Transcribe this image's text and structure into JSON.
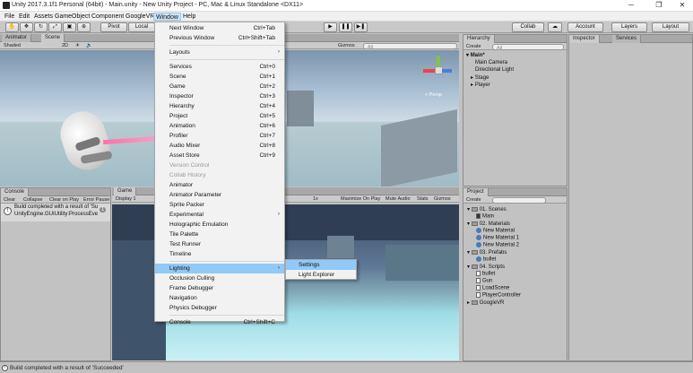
{
  "window": {
    "title": "Unity 2017.3.1f1 Personal (64bit) - Main.unity - New Unity Project - PC, Mac & Linux Standalone <DX11>",
    "minimize": "─",
    "maximize": "❐",
    "close": "✕"
  },
  "menubar": [
    "File",
    "Edit",
    "Assets",
    "GameObject",
    "Component",
    "GoogleVR",
    "Window",
    "Help"
  ],
  "toolbar": {
    "pivot": "Pivot",
    "local": "Local",
    "collab": "Collab",
    "account": "Account",
    "layers": "Layers",
    "layout": "Layout"
  },
  "scene_panel": {
    "tabs": [
      "Animator",
      "Scene"
    ],
    "shaded": "Shaded",
    "mode_2d": "2D",
    "gizmos": "Gizmos",
    "search_placeholder": "All",
    "persp": "< Persp"
  },
  "hierarchy": {
    "tab": "Hierarchy",
    "create": "Create",
    "search_placeholder": "All",
    "scene": "Main*",
    "items": [
      "Main Camera",
      "Directional Light",
      "Stage",
      "Player"
    ]
  },
  "inspector": {
    "tabs": [
      "Inspector",
      "Services"
    ]
  },
  "console": {
    "tab": "Console",
    "buttons": [
      "Clear",
      "Collapse",
      "Clear on Play",
      "Error Pause"
    ],
    "log_line1": "Build completed with a result of 'Su",
    "log_line2": "UnityEngine.GUIUtility:ProcessEve",
    "count": "1"
  },
  "game_panel": {
    "tab": "Game",
    "display": "Display 1",
    "scale": "1x",
    "options": [
      "Maximize On Play",
      "Mute Audio",
      "Stats",
      "Gizmos"
    ]
  },
  "project": {
    "tab": "Project",
    "create": "Create",
    "items": [
      {
        "label": "01. Scenes",
        "type": "folder",
        "depth": 0
      },
      {
        "label": "Main",
        "type": "scene",
        "depth": 1
      },
      {
        "label": "02. Materials",
        "type": "folder",
        "depth": 0
      },
      {
        "label": "New Material",
        "type": "asset",
        "depth": 1
      },
      {
        "label": "New Material 1",
        "type": "asset",
        "depth": 1
      },
      {
        "label": "New Material 2",
        "type": "asset",
        "depth": 1
      },
      {
        "label": "03. Prefabs",
        "type": "folder",
        "depth": 0
      },
      {
        "label": "bullet",
        "type": "asset",
        "depth": 1
      },
      {
        "label": "04. Scripts",
        "type": "folder",
        "depth": 0
      },
      {
        "label": "bullet",
        "type": "script",
        "depth": 1
      },
      {
        "label": "Gun",
        "type": "script",
        "depth": 1
      },
      {
        "label": "LoadScene",
        "type": "script",
        "depth": 1
      },
      {
        "label": "PlayerController",
        "type": "script",
        "depth": 1
      },
      {
        "label": "GoogleVR",
        "type": "folder",
        "depth": 0
      }
    ]
  },
  "window_menu": {
    "items": [
      {
        "label": "Next Window",
        "shortcut": "Ctrl+Tab"
      },
      {
        "label": "Previous Window",
        "shortcut": "Ctrl+Shift+Tab"
      },
      {
        "sep": true
      },
      {
        "label": "Layouts",
        "submenu": true
      },
      {
        "sep": true
      },
      {
        "label": "Services",
        "shortcut": "Ctrl+0"
      },
      {
        "label": "Scene",
        "shortcut": "Ctrl+1"
      },
      {
        "label": "Game",
        "shortcut": "Ctrl+2"
      },
      {
        "label": "Inspector",
        "shortcut": "Ctrl+3"
      },
      {
        "label": "Hierarchy",
        "shortcut": "Ctrl+4"
      },
      {
        "label": "Project",
        "shortcut": "Ctrl+5"
      },
      {
        "label": "Animation",
        "shortcut": "Ctrl+6"
      },
      {
        "label": "Profiler",
        "shortcut": "Ctrl+7"
      },
      {
        "label": "Audio Mixer",
        "shortcut": "Ctrl+8"
      },
      {
        "label": "Asset Store",
        "shortcut": "Ctrl+9"
      },
      {
        "label": "Version Control",
        "disabled": true
      },
      {
        "label": "Collab History",
        "disabled": true
      },
      {
        "label": "Animator"
      },
      {
        "label": "Animator Parameter"
      },
      {
        "label": "Sprite Packer"
      },
      {
        "label": "Experimental",
        "submenu": true
      },
      {
        "label": "Holographic Emulation"
      },
      {
        "label": "Tile Palette"
      },
      {
        "label": "Test Runner"
      },
      {
        "label": "Timeline"
      },
      {
        "sep": true
      },
      {
        "label": "Lighting",
        "submenu": true,
        "highlight": true
      },
      {
        "label": "Occlusion Culling"
      },
      {
        "label": "Frame Debugger"
      },
      {
        "label": "Navigation"
      },
      {
        "label": "Physics Debugger"
      },
      {
        "sep": true
      },
      {
        "label": "Console",
        "shortcut": "Ctrl+Shift+C"
      }
    ]
  },
  "lighting_submenu": [
    "Settings",
    "Light Explorer"
  ],
  "status": {
    "message": "Build completed with a result of 'Succeeded'"
  }
}
